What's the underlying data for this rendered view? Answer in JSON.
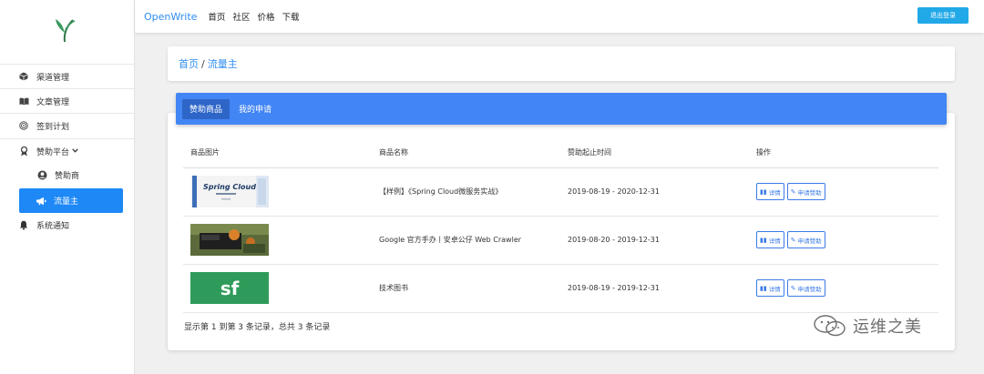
{
  "app": {
    "brand": "OpenWrite",
    "top_links": [
      "首页",
      "社区",
      "价格",
      "下载"
    ],
    "logout_label": "退出登录"
  },
  "sidebar": {
    "items": [
      {
        "label": "渠道管理",
        "icon": "cube-icon"
      },
      {
        "label": "文章管理",
        "icon": "book-icon"
      },
      {
        "label": "签到计划",
        "icon": "target-icon"
      },
      {
        "label": "赞助平台",
        "icon": "ribbon-icon",
        "expanded": true
      },
      {
        "label": "赞助商",
        "icon": "user-circle-icon"
      },
      {
        "label": "流量主",
        "icon": "megaphone-icon",
        "active": true
      },
      {
        "label": "系统通知",
        "icon": "bell-icon"
      }
    ]
  },
  "breadcrumb": {
    "home": "首页",
    "current": "流量主"
  },
  "tabs": [
    {
      "label": "赞助商品",
      "active": true
    },
    {
      "label": "我的申请",
      "active": false
    }
  ],
  "table": {
    "headers": [
      "商品图片",
      "商品名称",
      "赞助起止时间",
      "操作"
    ],
    "rows": [
      {
        "name": "【样例】《Spring Cloud微服务实战》",
        "period": "2019-08-19 - 2020-12-31",
        "thumb": "book-cover",
        "thumb_text": "Spring Cloud"
      },
      {
        "name": "Google 官方手办丨安卓公仔 Web Crawler",
        "period": "2019-08-20 - 2019-12-31",
        "thumb": "toy-photo"
      },
      {
        "name": "技术图书",
        "period": "2019-08-19 - 2019-12-31",
        "thumb": "sf-logo",
        "thumb_text": "sf"
      }
    ],
    "detail_label": "详情",
    "apply_label": "申请赞助"
  },
  "footer": {
    "summary": "显示第 1 到第 3 条记录，总共 3 条记录"
  },
  "watermark": {
    "text": "运维之美"
  },
  "colors": {
    "primary": "#4285f4",
    "active_nav": "#1e88f7",
    "logout": "#21a8e7",
    "sf_green": "#2f9b5a"
  }
}
